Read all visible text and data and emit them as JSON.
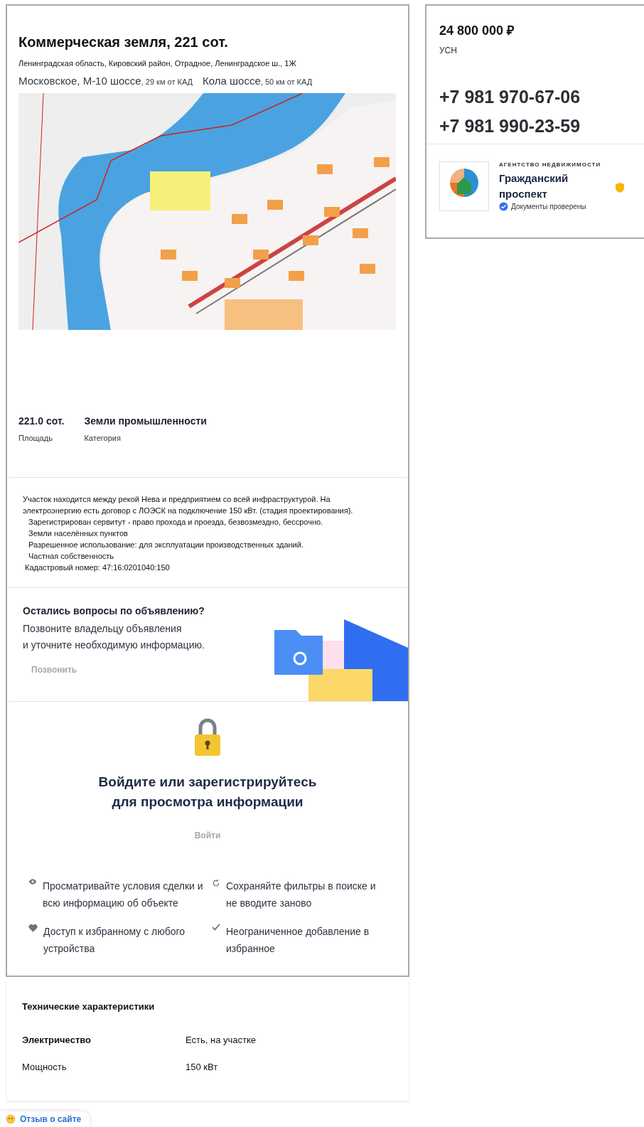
{
  "listing": {
    "title": "Коммерческая земля, 221 сот.",
    "address": "Ленинградская область, Кировский район, Отрадное, Ленинградское ш., 1Ж",
    "highways": [
      {
        "name": "Московское, М-10 шоссе",
        "distance": ", 29 км от КАД"
      },
      {
        "name": "Кола шоссе",
        "distance": ", 50 км от КАД"
      }
    ],
    "stats": [
      {
        "value": "221.0 сот.",
        "label": "Площадь"
      },
      {
        "value": "Земли промышленности",
        "label": "Категория"
      }
    ],
    "description": [
      {
        "kind": "paragraph",
        "text": "Участок находится между рекой Нева и предприятием со всей инфраструктурой. На электроэнергию есть договор с ЛОЭСК на подключение 150 кВт. (стадия проектирования)."
      },
      {
        "kind": "item",
        "text": "Зарегистрирован сервитут - право прохода и проезда, безвозмездно, бессрочно."
      },
      {
        "kind": "item",
        "text": "Земли населённых пунктов"
      },
      {
        "kind": "item",
        "text": "Разрешенное использование: для эксплуатации производственных зданий."
      },
      {
        "kind": "item",
        "text": "Частная собственность"
      },
      {
        "kind": "note",
        "text": "Кадастровый номер: 47:16:0201040:150"
      }
    ]
  },
  "questions": {
    "title": "Остались вопросы по объявлению?",
    "text_lines": [
      "Позвоните владельцу объявления",
      "и уточните необходимую информацию."
    ],
    "button": "Позвонить"
  },
  "login": {
    "title_lines": [
      "Войдите или зарегистрируйтесь",
      "для просмотра информации"
    ],
    "button": "Войти",
    "features": [
      {
        "kind": "eye",
        "text": "Просматривайте условия сделки и всю информацию об объекте"
      },
      {
        "kind": "refresh",
        "text": "Сохраняйте фильтры в поиске и не вводите заново"
      },
      {
        "kind": "heart",
        "text": "Доступ к избранному с любого устройства"
      },
      {
        "kind": "check",
        "text": "Неограниченное добавление в избранное"
      }
    ]
  },
  "tech": {
    "title": "Технические характеристики",
    "rows": [
      {
        "name": "Электричество",
        "value": "Есть, на участке",
        "bold": true
      },
      {
        "name": "Мощность",
        "value": "150 кВт",
        "bold": false
      }
    ]
  },
  "sidebar": {
    "price": "24 800 000 ₽",
    "tax": "УСН",
    "phones": [
      "+7 981 970-67-06",
      "+7 981 990-23-59"
    ],
    "agency": {
      "type": "АГЕНТСТВО НЕДВИЖИМОСТИ",
      "name": "Гражданский проспект",
      "verified": "Документы проверены"
    }
  },
  "feedback": "Отзыв о сайте"
}
